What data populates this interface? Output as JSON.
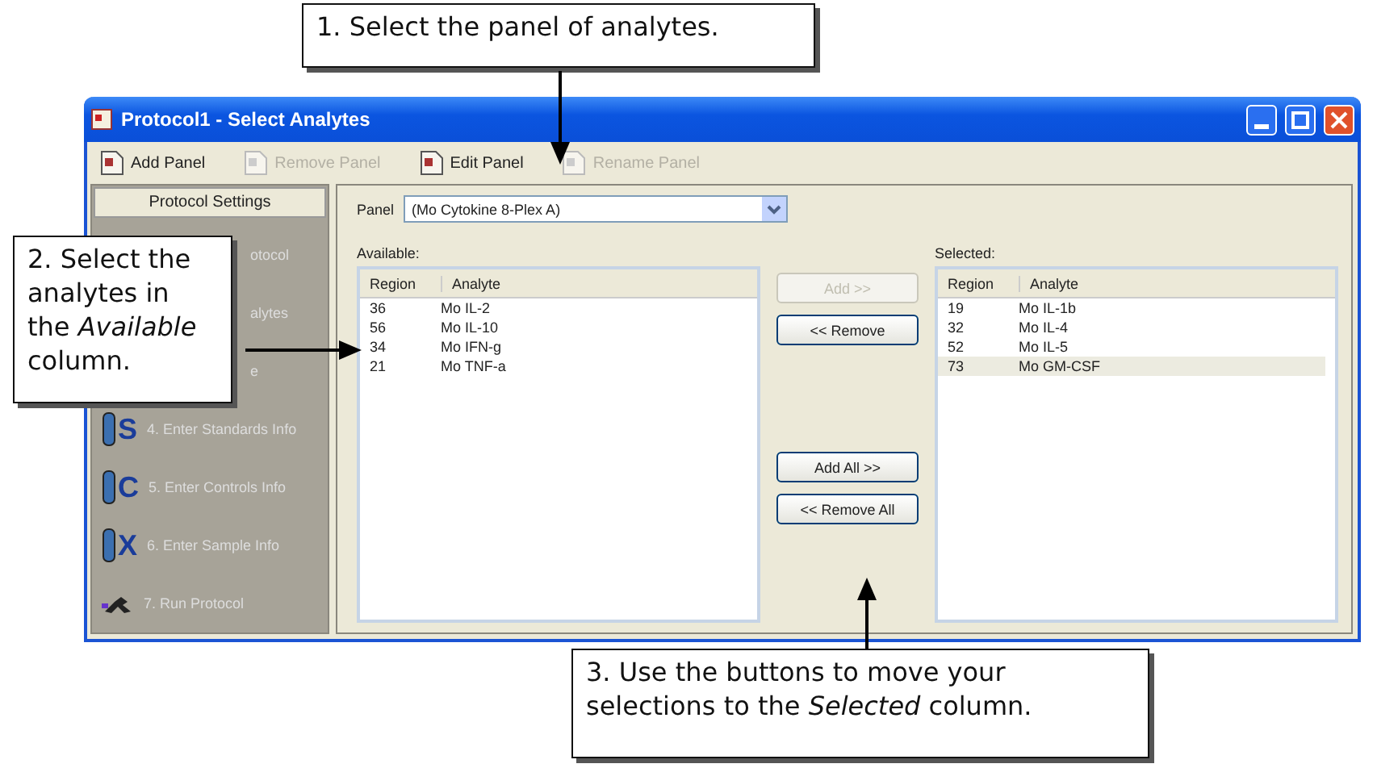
{
  "window": {
    "title": "Protocol1 - Select Analytes"
  },
  "toolbar": [
    {
      "label": "Add Panel",
      "disabled": false
    },
    {
      "label": "Remove Panel",
      "disabled": true
    },
    {
      "label": "Edit Panel",
      "disabled": false
    },
    {
      "label": "Rename Panel",
      "disabled": true
    }
  ],
  "sidebar": {
    "header": "Protocol Settings",
    "items": [
      {
        "kind": "partial",
        "label": "otocol"
      },
      {
        "kind": "partial",
        "label": "alytes"
      },
      {
        "kind": "partial",
        "label": "e"
      },
      {
        "kind": "step",
        "badge": "S",
        "label": "4. Enter Standards Info"
      },
      {
        "kind": "step",
        "badge": "C",
        "label": "5. Enter Controls Info"
      },
      {
        "kind": "step",
        "badge": "X",
        "label": "6. Enter Sample Info"
      },
      {
        "kind": "run",
        "label": "7. Run Protocol"
      }
    ]
  },
  "panel": {
    "label": "Panel",
    "value": "(Mo Cytokine 8-Plex A)"
  },
  "available": {
    "label": "Available:",
    "columns": [
      "Region",
      "Analyte"
    ],
    "rows": [
      {
        "region": "36",
        "analyte": "Mo IL-2",
        "selected": false
      },
      {
        "region": "56",
        "analyte": "Mo IL-10",
        "selected": false
      },
      {
        "region": "34",
        "analyte": "Mo IFN-g",
        "selected": false
      },
      {
        "region": "21",
        "analyte": "Mo TNF-a",
        "selected": false
      }
    ]
  },
  "buttons": [
    {
      "label": "Add >>",
      "disabled": true
    },
    {
      "label": "<< Remove",
      "disabled": false
    },
    {
      "label": "Add All >>",
      "disabled": false
    },
    {
      "label": "<< Remove All",
      "disabled": false
    }
  ],
  "selected": {
    "label": "Selected:",
    "columns": [
      "Region",
      "Analyte"
    ],
    "rows": [
      {
        "region": "19",
        "analyte": "Mo IL-1b",
        "selected": false
      },
      {
        "region": "32",
        "analyte": "Mo IL-4",
        "selected": false
      },
      {
        "region": "52",
        "analyte": "Mo IL-5",
        "selected": false
      },
      {
        "region": "73",
        "analyte": "Mo GM-CSF",
        "selected": true
      }
    ]
  },
  "callouts": [
    "1. Select the panel of analytes.",
    "2. Select the analytes in the *Available* column.",
    "3. Use the buttons to move your selections to the *Selected* column."
  ]
}
